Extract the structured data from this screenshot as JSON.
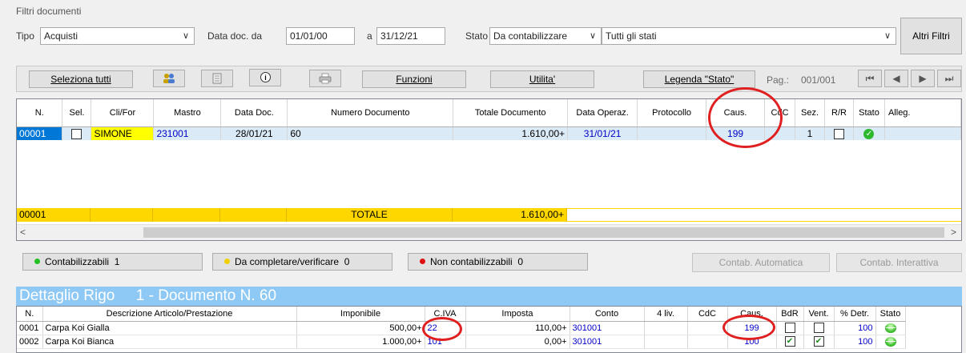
{
  "filters": {
    "group_label": "Filtri documenti",
    "tipo_label": "Tipo",
    "tipo_value": "Acquisti",
    "data_da_label": "Data doc. da",
    "data_da_value": "01/01/00",
    "a_label": "a",
    "data_a_value": "31/12/21",
    "stato_label": "Stato",
    "stato_value": "Da contabilizzare",
    "stati_value": "Tutti gli stati",
    "altri_filtri": "Altri Filtri"
  },
  "toolbar": {
    "seleziona_tutti": "Seleziona tutti",
    "funzioni": "Funzioni",
    "utilita": "Utilita'",
    "legenda": "Legenda \"Stato\"",
    "pag_label": "Pag.:",
    "pag_value": "001/001"
  },
  "grid": {
    "columns": [
      "N.",
      "Sel.",
      "Cli/For",
      "Mastro",
      "Data Doc.",
      "Numero Documento",
      "Totale Documento",
      "Data Operaz.",
      "Protocollo",
      "Caus.",
      "CdC",
      "Sez.",
      "R/R",
      "Stato",
      "Alleg."
    ],
    "rows": [
      {
        "n": "00001",
        "cli": "SIMONE",
        "mastro": "231001",
        "data_doc": "28/01/21",
        "numero": "60",
        "totale": "1.610,00+",
        "data_op": "31/01/21",
        "protocollo": "",
        "caus": "199",
        "cdc": "",
        "sez": "1"
      }
    ],
    "total": {
      "n": "00001",
      "label": "TOTALE",
      "value": "1.610,00+"
    }
  },
  "legend": {
    "contabilizzabili": "Contabilizzabili",
    "contabilizzabili_count": "1",
    "da_completare": "Da completare/verificare",
    "da_completare_count": "0",
    "non_contabilizzabili": "Non contabilizzabili",
    "non_contabilizzabili_count": "0",
    "contab_automatica": "Contab. Automatica",
    "contab_interattiva": "Contab. Interattiva"
  },
  "detail": {
    "title": "Dettaglio Rigo     1 - Documento N. 60",
    "columns": [
      "N.",
      "Descrizione Articolo/Prestazione",
      "Imponibile",
      "C.IVA",
      "Imposta",
      "Conto",
      "4 liv.",
      "CdC",
      "Caus.",
      "BdR",
      "Vent.",
      "% Detr.",
      "Stato"
    ],
    "rows": [
      {
        "n": "0001",
        "descr": "Carpa Koi Gialla",
        "imponibile": "500,00+",
        "civa": "22",
        "imposta": "110,00+",
        "conto": "301001",
        "liv4": "",
        "cdc": "",
        "caus": "199",
        "bdr": false,
        "vent": false,
        "detr": "100"
      },
      {
        "n": "0002",
        "descr": "Carpa Koi Bianca",
        "imponibile": "1.000,00+",
        "civa": "101",
        "imposta": "0,00+",
        "conto": "301001",
        "liv4": "",
        "cdc": "",
        "caus": "100",
        "bdr": true,
        "vent": true,
        "detr": "100"
      }
    ]
  },
  "colors": {
    "selected_row": "#dbeaf7",
    "total_row": "#ffd700",
    "detail_header": "#8ec8f5",
    "highlight": "#e02020"
  }
}
